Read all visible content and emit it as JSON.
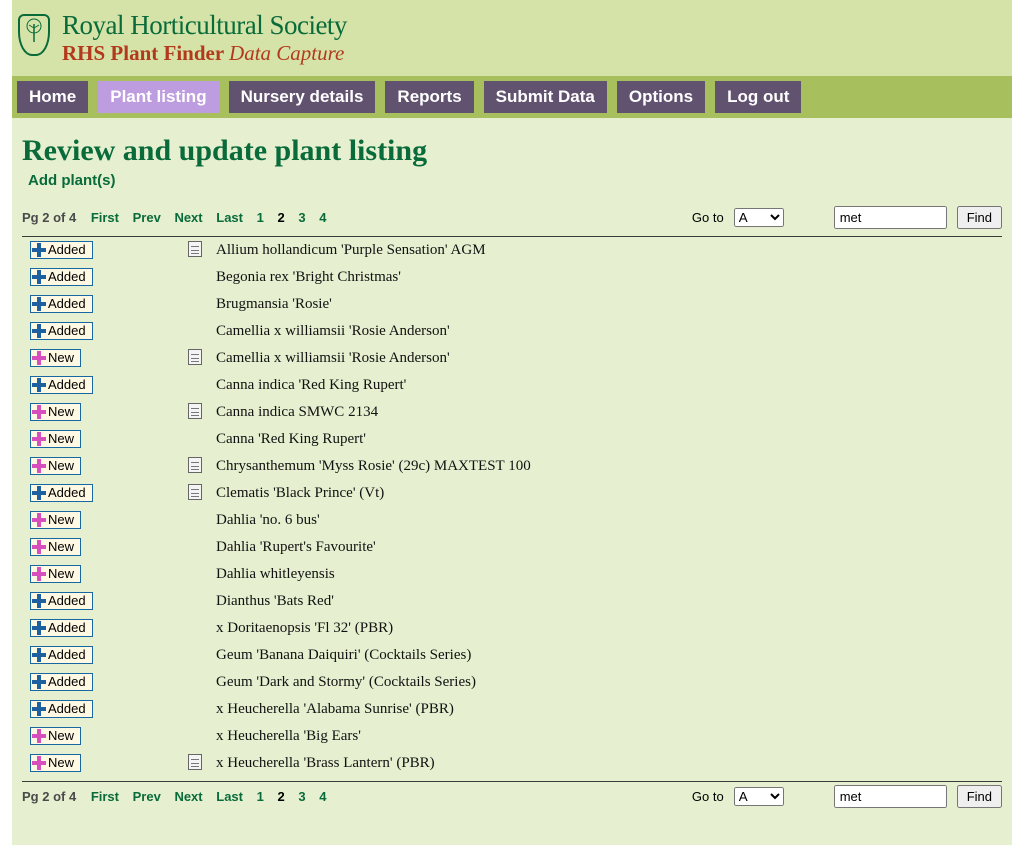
{
  "header": {
    "title1": "Royal Horticultural Society",
    "title2a": "RHS Plant Finder ",
    "title2b": "Data Capture"
  },
  "nav": {
    "home": "Home",
    "plant_listing": "Plant listing",
    "nursery_details": "Nursery details",
    "reports": "Reports",
    "submit_data": "Submit Data",
    "options": "Options",
    "log_out": "Log out"
  },
  "page": {
    "heading": "Review and update plant listing",
    "add_link": "Add plant(s)"
  },
  "pager": {
    "pg_label": "Pg 2 of 4",
    "first": "First",
    "prev": "Prev",
    "next": "Next",
    "last": "Last",
    "p1": "1",
    "p2": "2",
    "p3": "3",
    "p4": "4"
  },
  "goto": {
    "label": "Go to",
    "selected": "A",
    "find_value": "met",
    "find_btn": "Find"
  },
  "badges": {
    "added": "Added",
    "new": "New"
  },
  "rows": [
    {
      "status": "added",
      "note": true,
      "name": "Allium hollandicum 'Purple Sensation' AGM"
    },
    {
      "status": "added",
      "note": false,
      "name": "Begonia rex 'Bright Christmas'"
    },
    {
      "status": "added",
      "note": false,
      "name": "Brugmansia 'Rosie'"
    },
    {
      "status": "added",
      "note": false,
      "name": "Camellia x williamsii 'Rosie Anderson'"
    },
    {
      "status": "new",
      "note": true,
      "name": "Camellia x williamsii 'Rosie Anderson'"
    },
    {
      "status": "added",
      "note": false,
      "name": "Canna indica 'Red King Rupert'"
    },
    {
      "status": "new",
      "note": true,
      "name": "Canna indica SMWC 2134"
    },
    {
      "status": "new",
      "note": false,
      "name": "Canna 'Red King Rupert'"
    },
    {
      "status": "new",
      "note": true,
      "name": "Chrysanthemum 'Myss Rosie' (29c) MAXTEST 100"
    },
    {
      "status": "added",
      "note": true,
      "name": "Clematis 'Black Prince' (Vt)"
    },
    {
      "status": "new",
      "note": false,
      "name": "Dahlia 'no. 6 bus'"
    },
    {
      "status": "new",
      "note": false,
      "name": "Dahlia 'Rupert's Favourite'"
    },
    {
      "status": "new",
      "note": false,
      "name": "Dahlia whitleyensis"
    },
    {
      "status": "added",
      "note": false,
      "name": "Dianthus 'Bats Red'"
    },
    {
      "status": "added",
      "note": false,
      "name": "x Doritaenopsis 'Fl 32' (PBR)"
    },
    {
      "status": "added",
      "note": false,
      "name": "Geum 'Banana Daiquiri' (Cocktails Series)"
    },
    {
      "status": "added",
      "note": false,
      "name": "Geum 'Dark and Stormy' (Cocktails Series)"
    },
    {
      "status": "added",
      "note": false,
      "name": "x Heucherella 'Alabama Sunrise' (PBR)"
    },
    {
      "status": "new",
      "note": false,
      "name": "x Heucherella 'Big Ears'"
    },
    {
      "status": "new",
      "note": true,
      "name": "x Heucherella 'Brass Lantern' (PBR)"
    }
  ]
}
